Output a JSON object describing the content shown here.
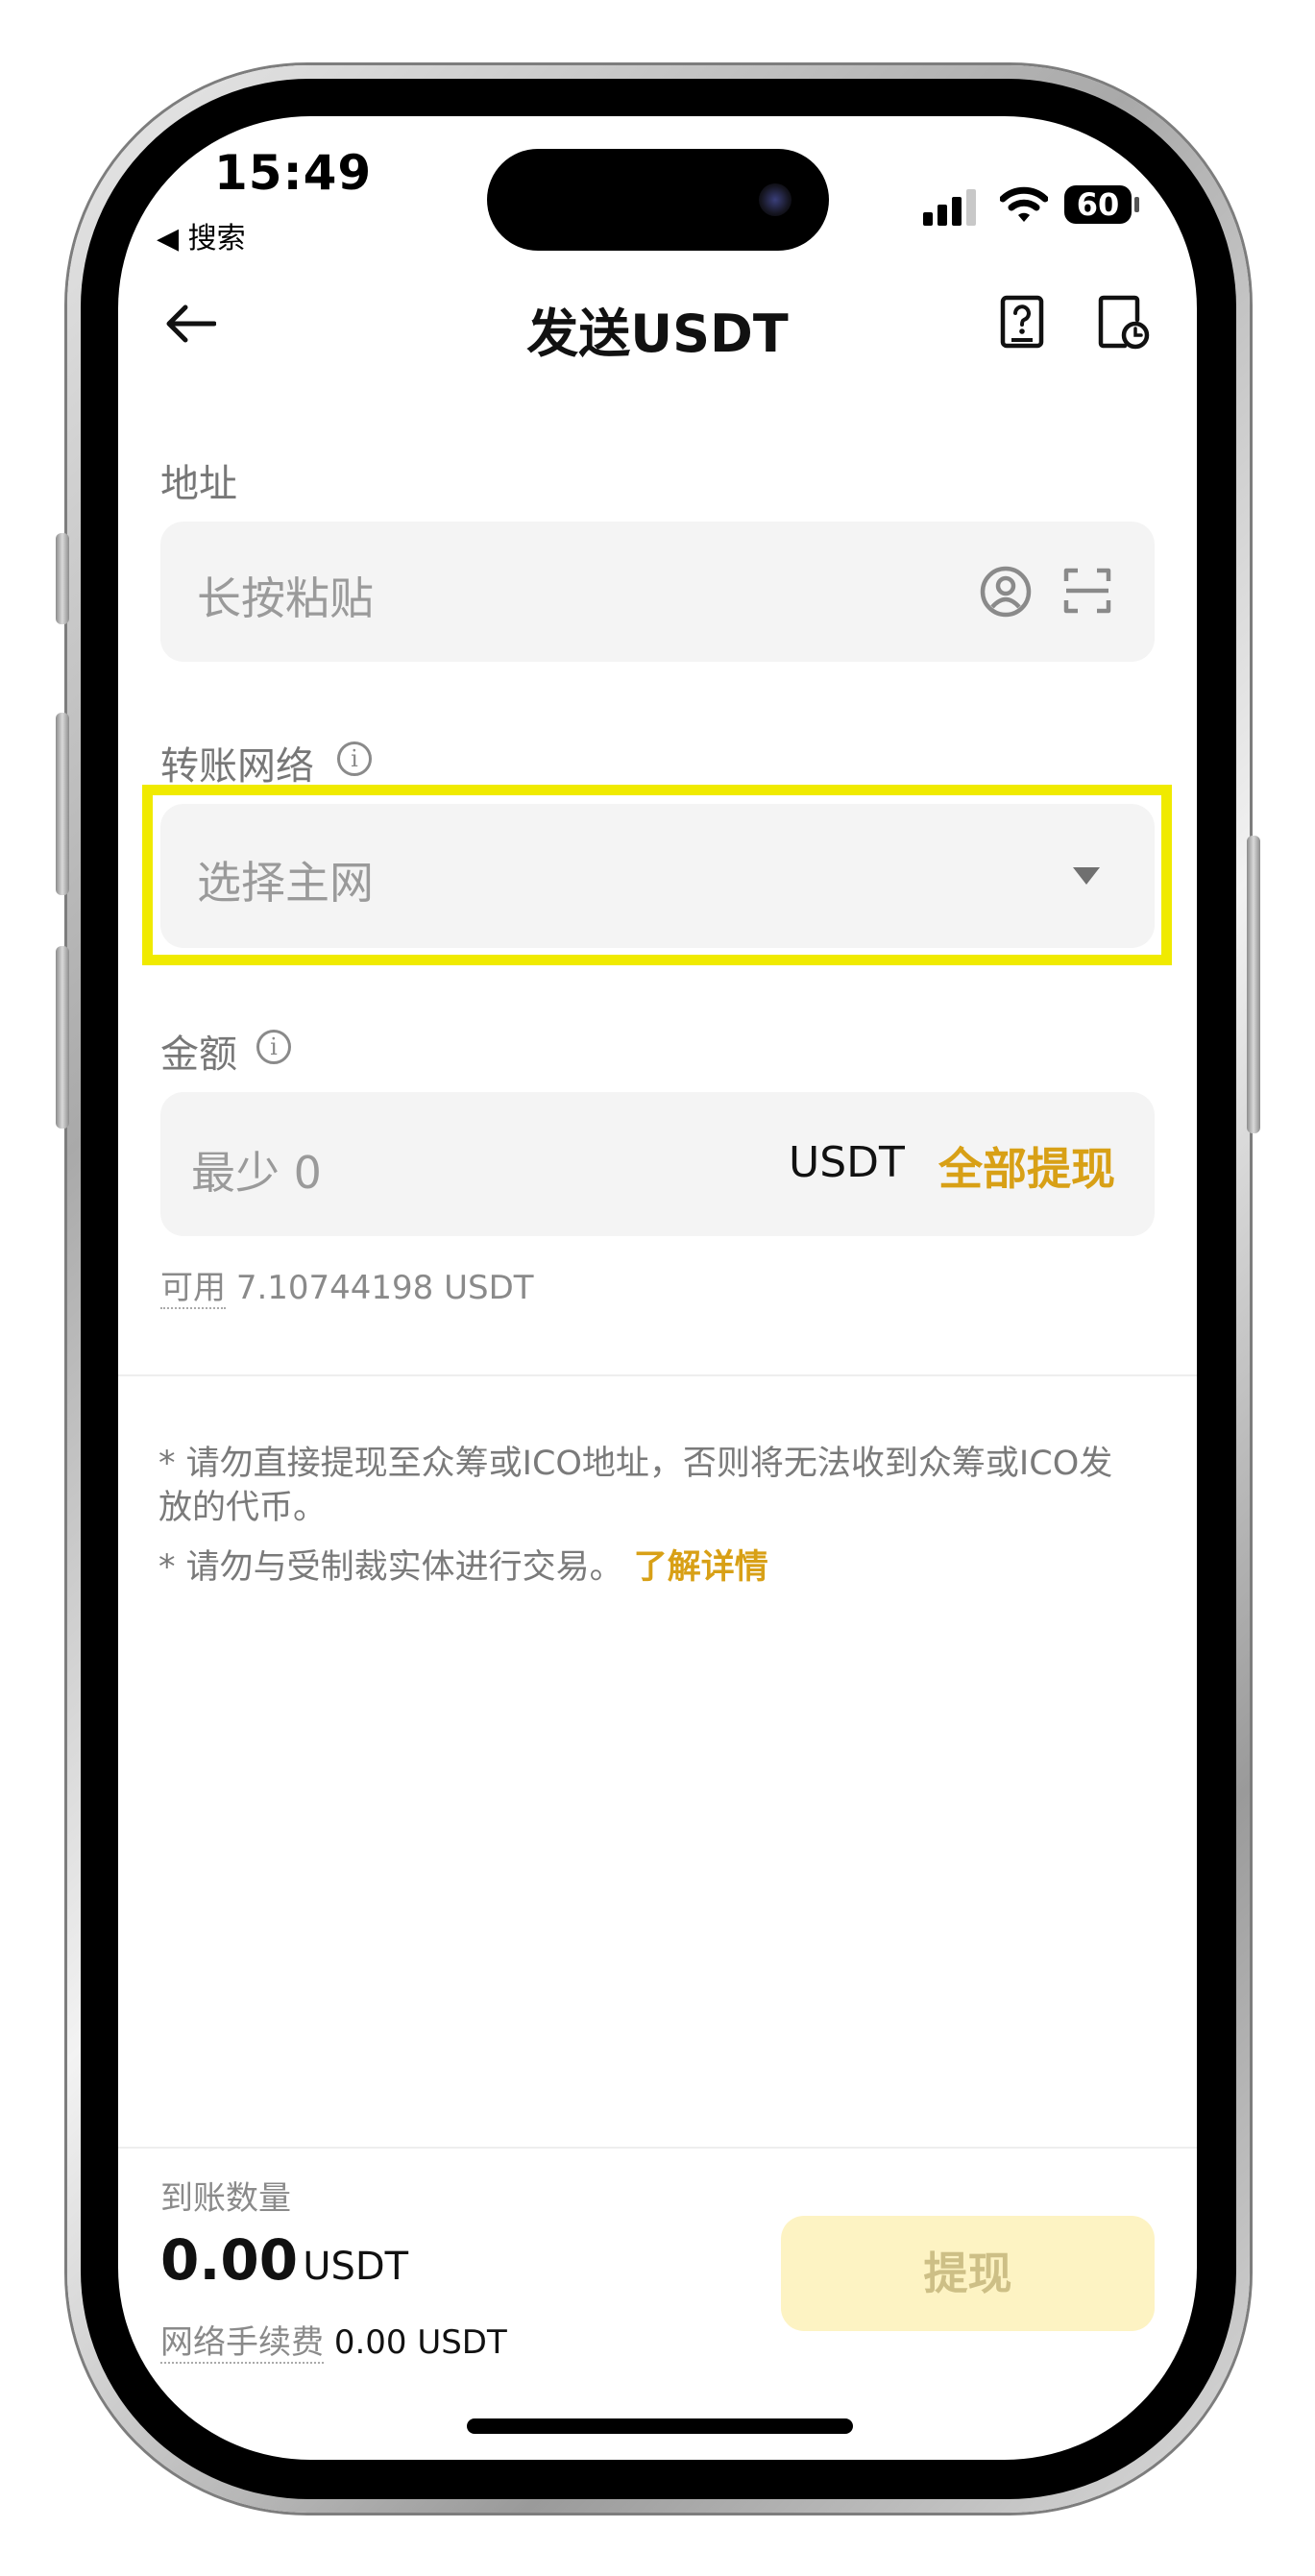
{
  "status_bar": {
    "time": "15:49",
    "back_app": "◀ 搜索",
    "battery": "60"
  },
  "header": {
    "title": "发送USDT"
  },
  "address": {
    "label": "地址",
    "placeholder": "长按粘贴"
  },
  "network": {
    "label": "转账网络",
    "placeholder": "选择主网"
  },
  "amount": {
    "label": "金额",
    "placeholder": "最少 0",
    "currency": "USDT",
    "max_label": "全部提现",
    "available_label": "可用",
    "available_value": "7.10744198 USDT"
  },
  "notes": {
    "line1": "* 请勿直接提现至众筹或ICO地址，否则将无法收到众筹或ICO发放的代币。",
    "line2": "* 请勿与受制裁实体进行交易。",
    "link": "了解详情"
  },
  "footer": {
    "receive_label": "到账数量",
    "receive_amount": "0.00",
    "receive_currency": "USDT",
    "fee_label": "网络手续费",
    "fee_value": "0.00 USDT",
    "submit_label": "提现"
  },
  "colors": {
    "accent": "#d8a016",
    "highlight": "#f0ea00",
    "disabled_button": "#fdf3c3"
  }
}
